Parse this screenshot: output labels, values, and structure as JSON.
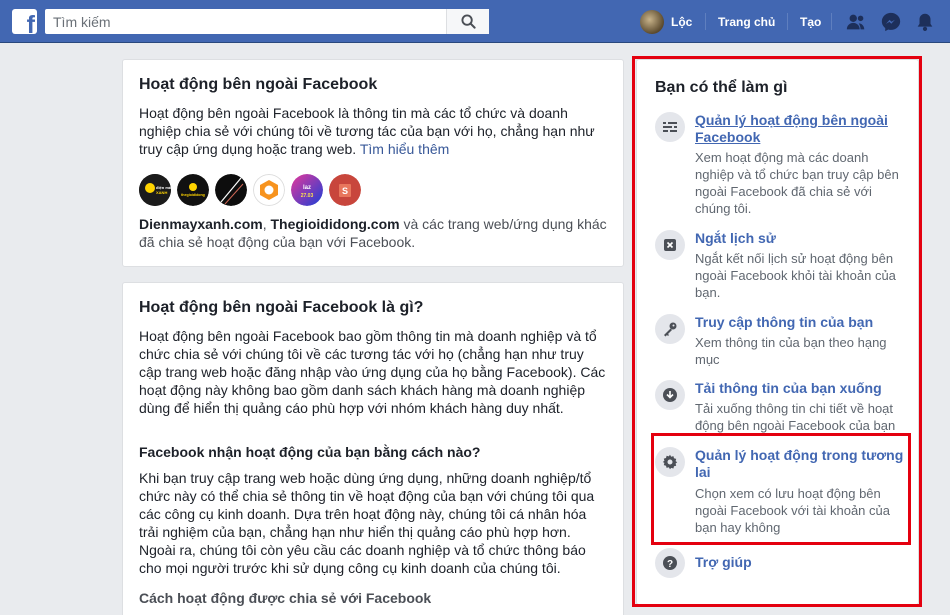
{
  "topbar": {
    "logo": "f",
    "search_placeholder": "Tìm kiếm",
    "user_name": "Lộc",
    "home_label": "Trang chủ",
    "create_label": "Tạo"
  },
  "card1": {
    "title": "Hoạt động bên ngoài Facebook",
    "body": "Hoạt động bên ngoài Facebook là thông tin mà các tổ chức và doanh nghiệp chia sẻ với chúng tôi về tương tác của bạn với họ, chẳng hạn như truy cập ứng dụng hoặc trang web.",
    "learn_more": "Tìm hiểu thêm",
    "logos": [
      {
        "name": "dienmayxanh",
        "text": "điện máy XANH",
        "bg": "#1b1b1b",
        "fg": "#ffd400"
      },
      {
        "name": "thegioididong",
        "text": "thegioididong",
        "bg": "#111111",
        "fg": "#ffd400"
      },
      {
        "name": "dark-app",
        "text": "",
        "bg": "#0d0d0d",
        "fg": "#ffffff"
      },
      {
        "name": "hexagon-app",
        "text": "",
        "bg": "#ffffff",
        "fg": "#f7931e"
      },
      {
        "name": "lazada",
        "text": "Lazada 27.03",
        "bg": "#2b4cd6",
        "fg": "#ffffff"
      },
      {
        "name": "shop-app",
        "text": "S",
        "bg": "#c8463c",
        "fg": "#ffffff"
      }
    ],
    "sites_bold_1": "Dienmayxanh.com",
    "sites_sep": ", ",
    "sites_bold_2": "Thegioididong.com",
    "sites_rest": " và các trang web/ứng dụng khác đã chia sẻ hoạt động của bạn với Facebook."
  },
  "card2": {
    "title": "Hoạt động bên ngoài Facebook là gì?",
    "p1": "Hoạt động bên ngoài Facebook bao gồm thông tin mà doanh nghiệp và tổ chức chia sẻ với chúng tôi về các tương tác với họ (chẳng hạn như truy cập trang web hoặc đăng nhập vào ứng dụng của họ bằng Facebook). Các hoạt động này không bao gồm danh sách khách hàng mà doanh nghiệp dùng để hiển thị quảng cáo phù hợp với nhóm khách hàng duy nhất.",
    "h2": "Facebook nhận hoạt động của bạn bằng cách nào?",
    "p2": "Khi bạn truy cập trang web hoặc dùng ứng dụng, những doanh nghiệp/tổ chức này có thể chia sẻ thông tin về hoạt động của bạn với chúng tôi qua các công cụ kinh doanh. Dựa trên hoạt động này, chúng tôi cá nhân hóa trải nghiệm của bạn, chẳng hạn như hiển thị quảng cáo phù hợp hơn. Ngoài ra, chúng tôi còn yêu cầu các doanh nghiệp và tổ chức thông báo cho mọi người trước khi sử dụng công cụ kinh doanh của chúng tôi.",
    "h3": "Cách hoạt động được chia sẻ với Facebook"
  },
  "side": {
    "title": "Bạn có thể làm gì",
    "items": [
      {
        "title": "Quản lý hoạt động bên ngoài Facebook",
        "desc": "Xem hoạt động mà các doanh nghiệp và tổ chức bạn truy cập bên ngoài Facebook đã chia sẻ với chúng tôi.",
        "icon": "manage-activity-icon"
      },
      {
        "title": "Ngắt lịch sử",
        "desc": "Ngắt kết nối lịch sử hoạt động bên ngoài Facebook khỏi tài khoản của bạn.",
        "icon": "clear-history-icon"
      },
      {
        "title": "Truy cập thông tin của bạn",
        "desc": "Xem thông tin của bạn theo hạng mục",
        "icon": "key-icon"
      },
      {
        "title": "Tải thông tin của bạn xuống",
        "desc": "Tải xuống thông tin chi tiết về hoạt động bên ngoài Facebook của bạn",
        "icon": "download-icon"
      },
      {
        "title": "Quản lý hoạt động trong tương lai",
        "desc": "Chọn xem có lưu hoạt động bên ngoài Facebook với tài khoản của bạn hay không",
        "icon": "gear-icon"
      },
      {
        "title": "Trợ giúp",
        "desc": "",
        "icon": "help-icon"
      }
    ]
  },
  "colors": {
    "topbar": "#4267b2",
    "link": "#385898",
    "highlight": "#e4000f"
  }
}
